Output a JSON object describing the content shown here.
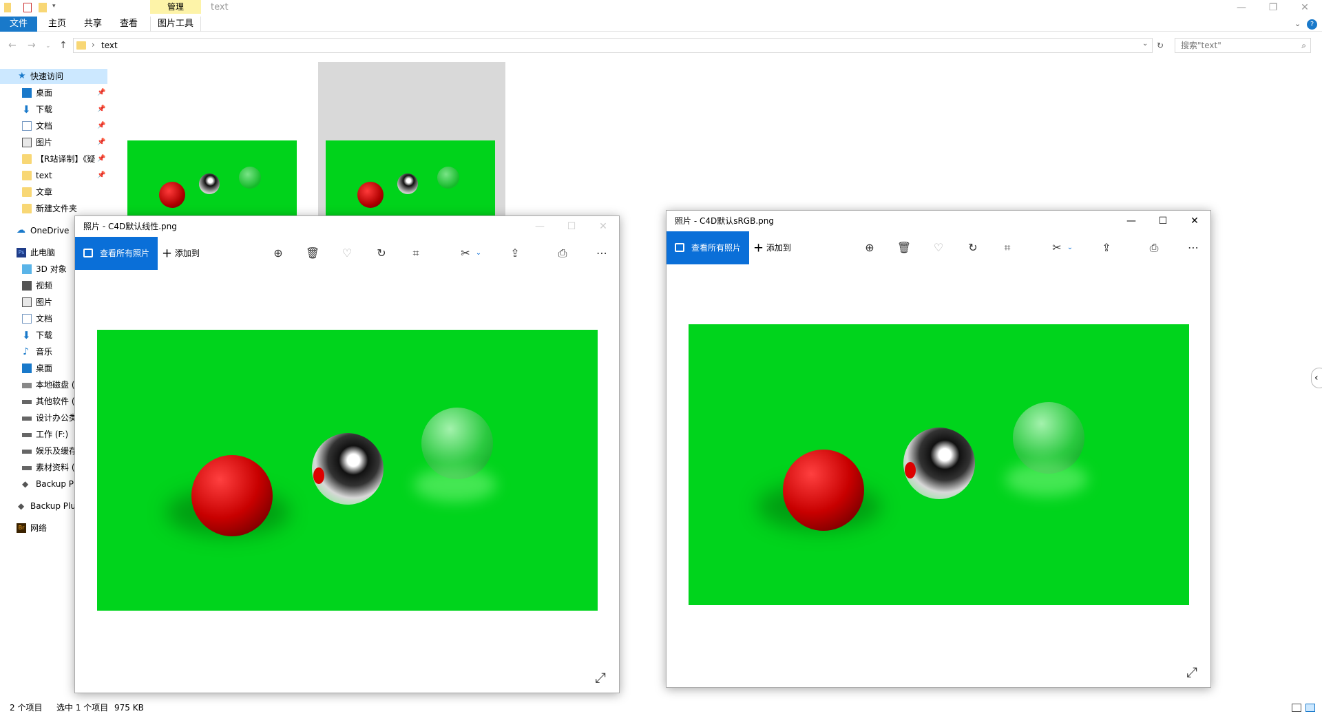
{
  "explorer": {
    "context_tab_header": "管理",
    "window_title": "text",
    "tabs": [
      "文件",
      "主页",
      "共享",
      "查看"
    ],
    "context_tab": "图片工具",
    "address_path": "text",
    "search_placeholder": "搜索\"text\"",
    "nav": {
      "quick_access": "快速访问",
      "quick_items": [
        "桌面",
        "下载",
        "文档",
        "图片",
        "【R站译制】《疑",
        "text",
        "文章",
        "新建文件夹"
      ],
      "onedrive": "OneDrive",
      "this_pc": "此电脑",
      "pc_items": [
        "3D 对象",
        "视频",
        "图片",
        "文档",
        "下载",
        "音乐",
        "桌面",
        "本地磁盘 (",
        "其他软件 (",
        "设计办公类",
        "工作 (F:)",
        "娱乐及缓存",
        "素材资料 (",
        "Backup Pl"
      ],
      "backup": "Backup Plu",
      "network": "网络"
    },
    "status": {
      "count": "2 个项目",
      "selected": "选中 1 个项目",
      "size": "975 KB"
    }
  },
  "photo_left": {
    "title": "照片 - C4D默认线性.png",
    "view_all": "查看所有照片",
    "add_to": "添加到"
  },
  "photo_right": {
    "title": "照片 - C4D默认sRGB.png",
    "view_all": "查看所有照片",
    "add_to": "添加到"
  },
  "icons": [
    "zoom-icon",
    "delete-icon",
    "favorite-icon",
    "rotate-icon",
    "crop-icon",
    "edit-icon",
    "share-icon",
    "print-icon",
    "more-icon",
    "expand-icon"
  ],
  "colors": {
    "accent": "#0a6fd8",
    "file_tab": "#1979ca",
    "photo_bg": "#00d41c"
  }
}
